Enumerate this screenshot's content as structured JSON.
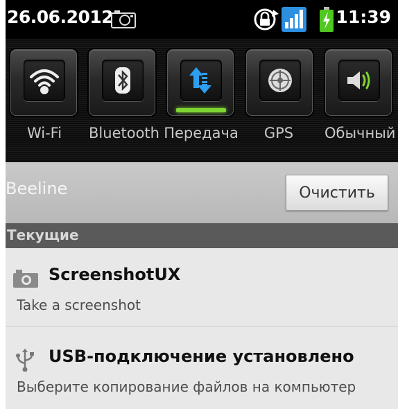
{
  "status_bar": {
    "date": "26.06.2012",
    "time": "11:39",
    "icons": [
      "camera-icon",
      "rotation-lock-icon",
      "signal-icon",
      "battery-charging-icon"
    ]
  },
  "toggles": [
    {
      "label": "Wi-Fi",
      "icon": "wifi-icon",
      "on": false
    },
    {
      "label": "Bluetooth",
      "icon": "bluetooth-icon",
      "on": false
    },
    {
      "label": "Передача",
      "icon": "data-transfer-icon",
      "on": true
    },
    {
      "label": "GPS",
      "icon": "gps-icon",
      "on": false
    },
    {
      "label": "Обычный",
      "icon": "sound-icon",
      "on": false
    }
  ],
  "carrier": {
    "name": "Beeline",
    "clear_label": "Очистить"
  },
  "section": {
    "title": "Текущие"
  },
  "notifications": [
    {
      "icon": "camera-icon",
      "title": "ScreenshotUX",
      "text": "Take a screenshot"
    },
    {
      "icon": "usb-icon",
      "title": "USB-подключение установлено",
      "text": "Выберите копирование файлов на компьютер"
    }
  ],
  "colors": {
    "toggle_on": "#7fd633",
    "signal_blue": "#2d8fe0",
    "battery_green": "#4fc81f"
  }
}
